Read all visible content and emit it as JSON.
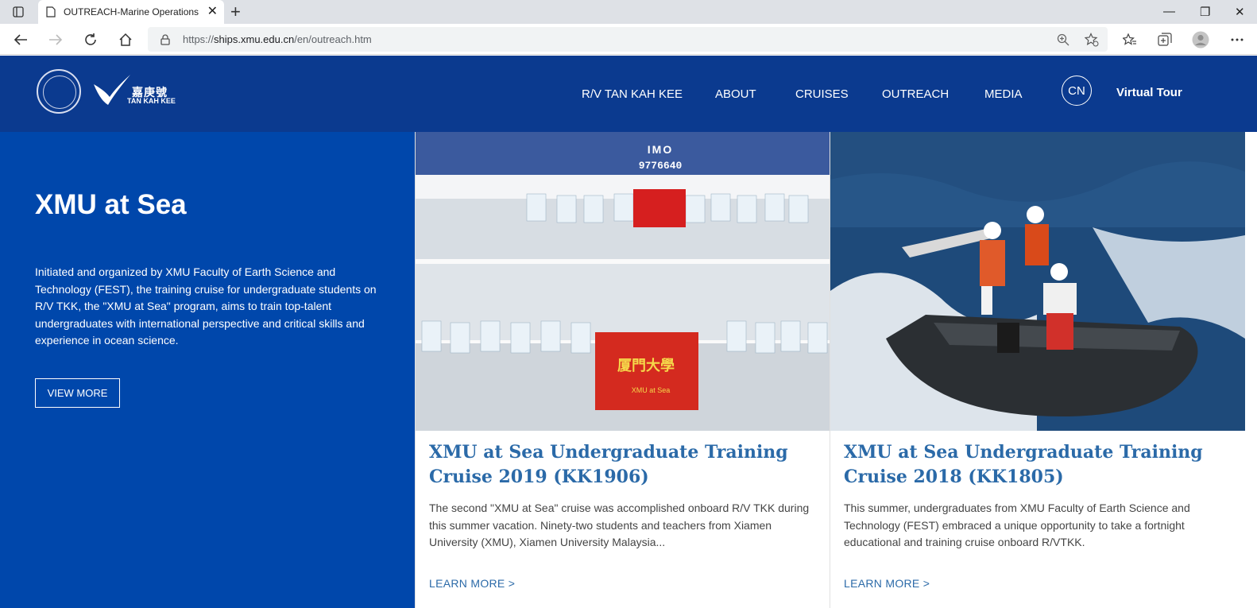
{
  "browser": {
    "tab_title": "OUTREACH-Marine Operations,",
    "url_prefix": "https://",
    "url_host": "ships.xmu.edu.cn",
    "url_path": "/en/outreach.htm"
  },
  "header": {
    "logo_cn": "嘉庚號",
    "logo_en": "TAN KAH KEE",
    "nav": [
      "R/V TAN KAH KEE",
      "ABOUT",
      "CRUISES",
      "OUTREACH",
      "MEDIA"
    ],
    "lang": "CN",
    "virtual_tour": "Virtual Tour",
    "brand_color": "#0b3a8f"
  },
  "hero": {
    "title": "XMU at Sea",
    "text": "Initiated and organized by XMU Faculty of Earth Science and Technology (FEST), the training cruise for undergraduate students on R/V TKK, the \"XMU at Sea\" program, aims to train top-talent undergraduates with international perspective and critical skills and experience in ocean science.",
    "button": "VIEW MORE",
    "bg_color": "#0047ab"
  },
  "cards": [
    {
      "ship_label_1": "IMO",
      "ship_label_2": "9776640",
      "banner_text": "厦門大學",
      "banner_sub": "XMU at Sea",
      "title": "XMU at Sea Undergraduate Training Cruise 2019 (KK1906)",
      "text": "The second \"XMU at Sea\" cruise was accomplished onboard R/V TKK during this summer vacation. Ninety-two students and teachers from Xiamen University (XMU), Xiamen University Malaysia...",
      "link": "LEARN MORE >"
    },
    {
      "title": "XMU at Sea Undergraduate Training Cruise 2018 (KK1805)",
      "text": "This summer, undergraduates from XMU Faculty of Earth Science and Technology (FEST) embraced a unique opportunity to take a fortnight educational and training cruise onboard R/VTKK.",
      "link": "LEARN MORE >"
    }
  ]
}
